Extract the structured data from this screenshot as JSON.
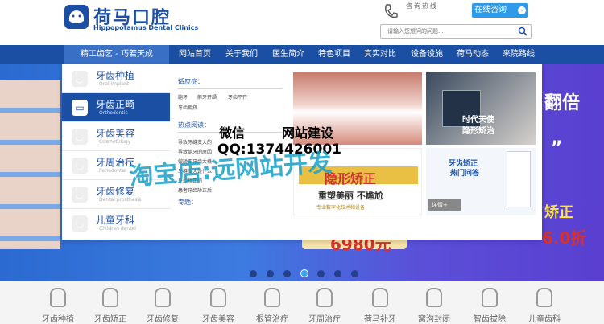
{
  "header": {
    "logo_cn": "荷马口腔",
    "logo_en": "Hippopotamus Dental Clinics",
    "hotline_label": "咨询热线",
    "consult_button": "在线咨询",
    "consult_arrow": "›",
    "search_placeholder": "请输入您想问的问题..."
  },
  "nav": {
    "slogan": "精工齿艺 - 巧若天成",
    "items": [
      "网站首页",
      "关于我们",
      "医生简介",
      "特色项目",
      "真实对比",
      "设备设施",
      "荷马动态",
      "来院路线"
    ]
  },
  "menu": {
    "items": [
      {
        "label": "牙齿种植",
        "sub": "Oral implant",
        "icon": "tooth"
      },
      {
        "label": "牙齿正畸",
        "sub": "Orthodontic",
        "icon": "braces"
      },
      {
        "label": "牙齿美容",
        "sub": "Cosmetology",
        "icon": "tooth"
      },
      {
        "label": "牙周治疗",
        "sub": "Periodontal",
        "icon": "tooth"
      },
      {
        "label": "牙齿修复",
        "sub": "Dental prosthesis",
        "icon": "tooth"
      },
      {
        "label": "儿童牙科",
        "sub": "Children dental",
        "icon": "tooth"
      }
    ],
    "active_index": 1
  },
  "panel": {
    "indications_title": "适应症：",
    "tags": [
      "龅牙",
      "前牙开颌",
      "牙齿不齐",
      "牙齿拥挤"
    ],
    "hot_title": "热点阅读：",
    "articles": [
      "导致牙缝变大的",
      "导致龅牙的原因",
      "做矫正牙齿大概",
      "牙缝变大是什么",
      "牙齿矫正的",
      "患者牙齿矫正后"
    ],
    "topic_title": "专题：",
    "detail_button": "详情+"
  },
  "promo": {
    "title": "隐形矫正",
    "subtitle": "重塑美丽 不尴尬",
    "footer": "专业数字化技术和设备"
  },
  "woman_card": {
    "text": "时代天使 隐形矫治"
  },
  "qa_card": {
    "title": "牙齿矫正",
    "subtitle": "热门问答",
    "detail_button": "详情+"
  },
  "hero": {
    "right_title": "翻倍",
    "right_sub": "矫正",
    "price_left": "6980元",
    "price_right": "6.0折",
    "quote": "”",
    "slides": 7,
    "active_slide": 3
  },
  "watermark": {
    "line1": "微信",
    "line2": "QQ:1374426001",
    "line3": "网站建设",
    "line4": "淘宝店:远网站开发"
  },
  "services": [
    "牙齿种植",
    "牙齿矫正",
    "牙齿修复",
    "牙齿美容",
    "根管治疗",
    "牙周治疗",
    "荷马补牙",
    "窝沟封闭",
    "智齿拔除",
    "儿童齿科"
  ],
  "colors": {
    "brand": "#1b4fa3",
    "accent": "#2f9be8"
  }
}
